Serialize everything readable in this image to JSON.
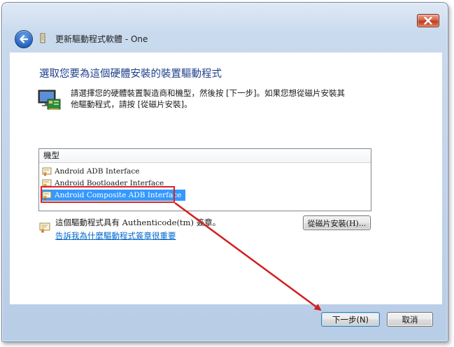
{
  "window": {
    "title": "更新驅動程式軟體 - One",
    "close_icon": "close-icon",
    "back_icon": "back-arrow-icon"
  },
  "page": {
    "heading": "選取您要為這個硬體安裝的裝置驅動程式",
    "instruction": "請選擇您的硬體裝置製造商和機型，然後按 [下一步]。如果您想從磁片安裝其他驅動程式，請按 [從磁片安裝]。"
  },
  "list": {
    "header": "機型",
    "items": [
      {
        "label": "Android ADB Interface",
        "selected": false
      },
      {
        "label": "Android Bootloader Interface",
        "selected": false
      },
      {
        "label": "Android Composite ADB Interface",
        "selected": true
      }
    ]
  },
  "signature": {
    "text_prefix": "這個驅動程式具有 ",
    "text_serif": "Authenticode(tm)",
    "text_suffix": " 簽章。",
    "link": "告訴我為什麼驅動程式簽章很重要"
  },
  "buttons": {
    "have_disk": "從磁片安裝(H)...",
    "next": "下一步(N)",
    "cancel": "取消"
  },
  "colors": {
    "heading": "#1e3f8a",
    "selection": "#3399ff",
    "annotation": "#e02020",
    "link": "#0066cc"
  }
}
